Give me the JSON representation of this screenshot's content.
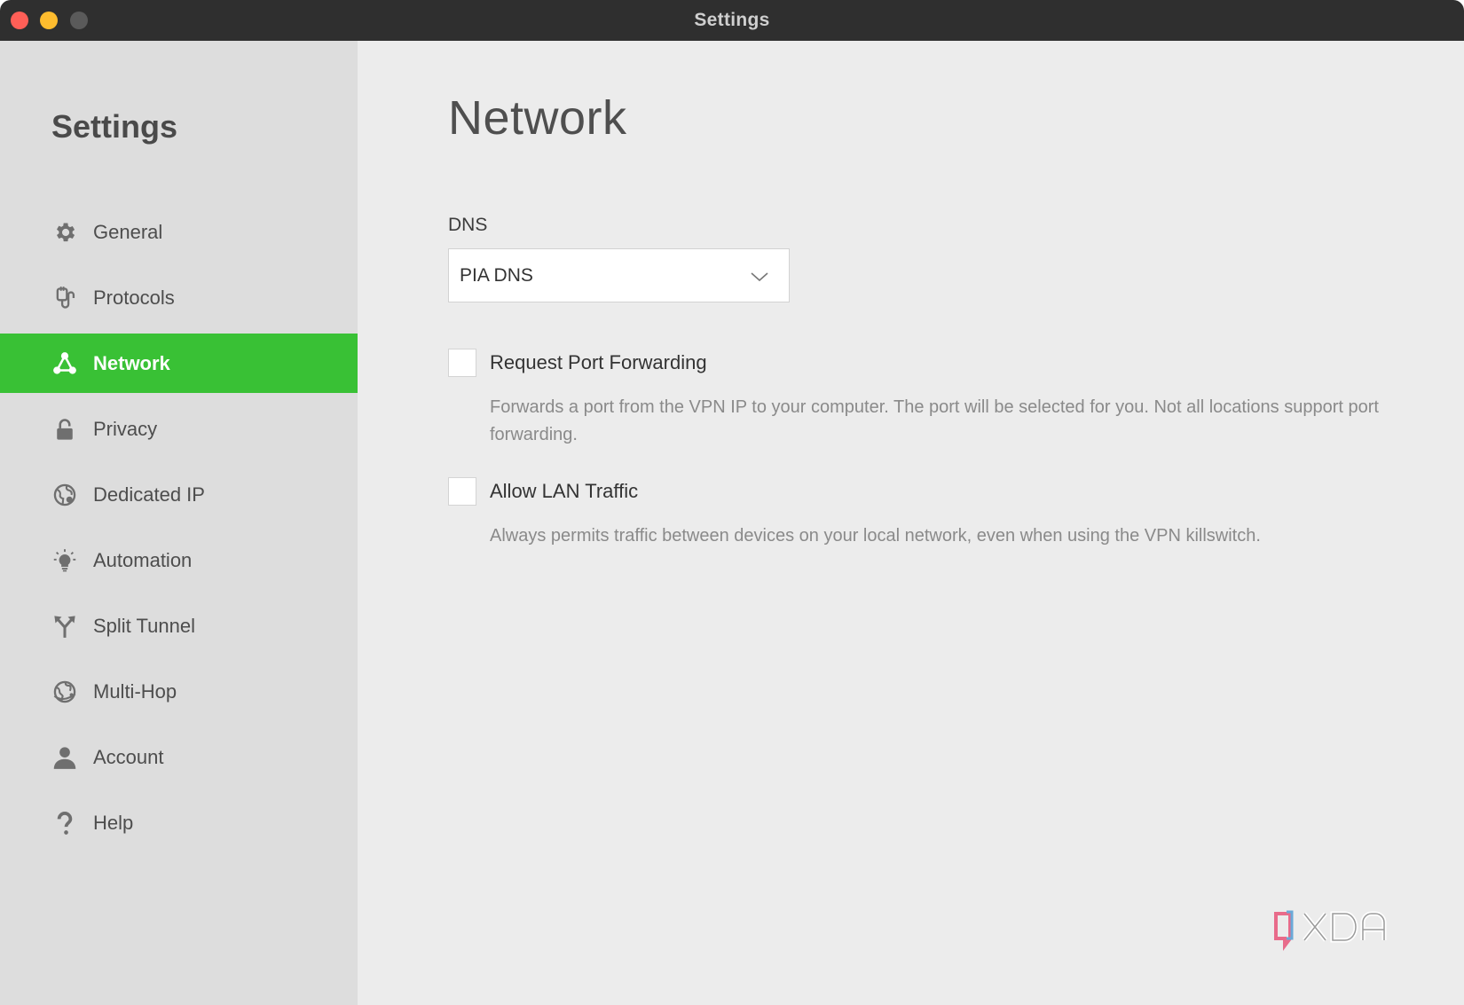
{
  "window": {
    "title": "Settings"
  },
  "sidebar": {
    "title": "Settings",
    "items": [
      {
        "label": "General",
        "icon": "gear-icon",
        "active": false
      },
      {
        "label": "Protocols",
        "icon": "protocols-icon",
        "active": false
      },
      {
        "label": "Network",
        "icon": "network-icon",
        "active": true
      },
      {
        "label": "Privacy",
        "icon": "lock-icon",
        "active": false
      },
      {
        "label": "Dedicated IP",
        "icon": "dedicated-ip-globe-icon",
        "active": false
      },
      {
        "label": "Automation",
        "icon": "lightbulb-icon",
        "active": false
      },
      {
        "label": "Split Tunnel",
        "icon": "split-tunnel-icon",
        "active": false
      },
      {
        "label": "Multi-Hop",
        "icon": "multi-hop-globe-icon",
        "active": false
      },
      {
        "label": "Account",
        "icon": "user-icon",
        "active": false
      },
      {
        "label": "Help",
        "icon": "question-icon",
        "active": false
      }
    ],
    "active_color": "#39c135"
  },
  "main": {
    "title": "Network",
    "dns": {
      "label": "DNS",
      "selected": "PIA DNS"
    },
    "port_forwarding": {
      "label": "Request Port Forwarding",
      "checked": false,
      "description": "Forwards a port from the VPN IP to your computer. The port will be selected for you. Not all locations support port forwarding."
    },
    "lan_traffic": {
      "label": "Allow LAN Traffic",
      "checked": false,
      "description": "Always permits traffic between devices on your local network, even when using the VPN killswitch."
    }
  },
  "watermark": {
    "text": "XDA"
  }
}
